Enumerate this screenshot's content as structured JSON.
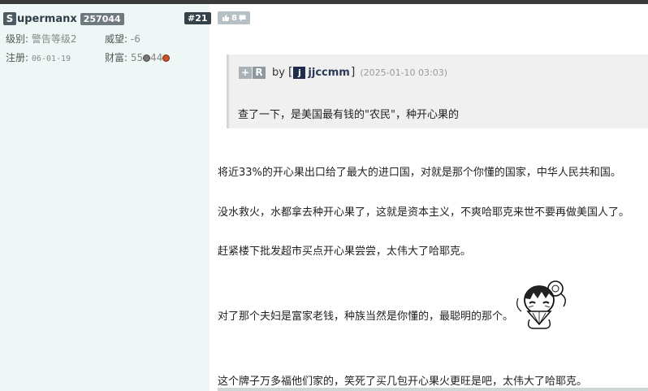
{
  "user": {
    "initial": "S",
    "name_rest": "upermanx",
    "uid": "257044",
    "floor": "#21",
    "level_label": "级别:",
    "level_value": "警告等级2",
    "prestige_label": "威望:",
    "prestige_value": "-6",
    "reg_label": "注册:",
    "reg_value": "06-01-19",
    "wealth_label": "财富:",
    "wealth_num1": "55",
    "wealth_num2": "44"
  },
  "like": {
    "count": "8"
  },
  "quote": {
    "plus": "+",
    "r": "R",
    "by": "by",
    "avatar_letter": "j",
    "user": "jjccmm",
    "time": "(2025-01-10 03:03)",
    "text": "查了一下，是美国最有钱的\"农民\"，种开心果的"
  },
  "post": {
    "p1": "将近33%的开心果出口给了最大的进口国，对就是那个你懂的国家，中华人民共和国。",
    "p2": "没水救火，水都拿去种开心果了，这就是资本主义，不爽哈耶克来世不要再做美国人了。",
    "p3": "赶紧楼下批发超市买点开心果尝尝，太伟大了哈耶克。",
    "p4": "对了那个夫妇是富家老钱，种族当然是你懂的，最聪明的那个。",
    "p5": "这个牌子万多福他们家的，笑死了买几包开心果火更旺是吧，太伟大了哈耶克。"
  }
}
